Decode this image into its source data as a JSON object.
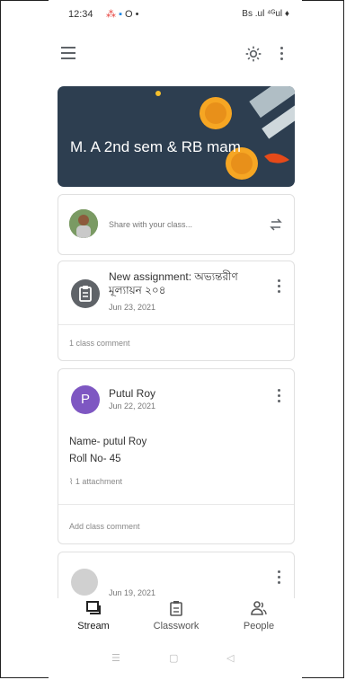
{
  "status_bar": {
    "time": "12:34",
    "right_icons": "Bs .ul ⁴ᴳul ♦"
  },
  "class": {
    "name": "M. A 2nd sem & RB mam",
    "banner_color": "#2d3e50"
  },
  "share": {
    "placeholder": "Share with your class..."
  },
  "stream": [
    {
      "kind": "assignment",
      "title": "New assignment: অভ্যন্তরীণ মূল্যায়ন ২০৪",
      "date": "Jun 23, 2021",
      "comment_text": "1 class comment"
    },
    {
      "kind": "post",
      "author": "Putul Roy",
      "avatar_letter": "P",
      "avatar_color": "#7e57c2",
      "date": "Jun 22, 2021",
      "body_line1": "Name- putul Roy",
      "body_line2": "Roll No- 45",
      "attachments": "1 attachment",
      "add_comment": "Add class comment"
    },
    {
      "kind": "post",
      "date": "Jun 19, 2021"
    }
  ],
  "bottom_nav": [
    {
      "label": "Stream",
      "icon": "stream-icon",
      "active": true
    },
    {
      "label": "Classwork",
      "icon": "classwork-icon",
      "active": false
    },
    {
      "label": "People",
      "icon": "people-icon",
      "active": false
    }
  ],
  "system_nav": {
    "recents": "☰",
    "home": "▢",
    "back": "◁"
  }
}
